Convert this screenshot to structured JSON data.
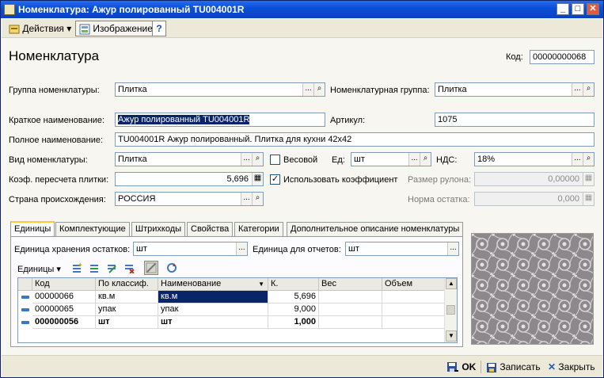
{
  "window": {
    "title": "Номенклатура: Ажур полированный TU004001R"
  },
  "toolbar": {
    "actions_label": "Действия",
    "image_label": "Изображение",
    "help_label": "?"
  },
  "form": {
    "heading": "Номенклатура",
    "code_label": "Код:",
    "code_value": "00000000068",
    "group_label": "Группа номенклатуры:",
    "group_value": "Плитка",
    "nom_group_label": "Номенклатурная группа:",
    "nom_group_value": "Плитка",
    "short_name_label": "Краткое наименование:",
    "short_name_value": "Ажур полированный TU004001R",
    "article_label": "Артикул:",
    "article_value": "1075",
    "full_name_label": "Полное наименование:",
    "full_name_value": "TU004001R Ажур полированный. Плитка для кухни 42x42",
    "type_label": "Вид номенклатуры:",
    "type_value": "Плитка",
    "weight_label": "Весовой",
    "unit_label": "Ед:",
    "unit_value": "шт",
    "vat_label": "НДС:",
    "vat_value": "18%",
    "coef_label": "Коэф. пересчета плитки:",
    "coef_value": "5,696",
    "use_coef_label": "Использовать коэффициент",
    "roll_label": "Размер рулона:",
    "roll_value": "0,00000",
    "country_label": "Страна происхождения:",
    "country_value": "РОССИЯ",
    "rest_label": "Норма остатка:",
    "rest_value": "0,000",
    "dots": "...",
    "search": "🔍"
  },
  "tabs": [
    "Единицы",
    "Комплектующие",
    "Штрихкоды",
    "Свойства",
    "Категории",
    "Дополнительное описание номенклатуры"
  ],
  "units_panel": {
    "storage_label": "Единица хранения остатков:",
    "storage_value": "шт",
    "report_label": "Единица для отчетов:",
    "report_value": "шт",
    "units_menu": "Единицы"
  },
  "table": {
    "columns": [
      "Код",
      "По классиф.",
      "Наименование",
      "К.",
      "Вес",
      "Объем"
    ],
    "rows": [
      [
        "00000066",
        "кв.м",
        "кв.м",
        "5,696",
        "",
        ""
      ],
      [
        "00000065",
        "упак",
        "упак",
        "9,000",
        "",
        ""
      ],
      [
        "000000056",
        "шт",
        "шт",
        "1,000",
        "",
        ""
      ]
    ]
  },
  "footer": {
    "ok_label": "OK",
    "save_label": "Записать",
    "close_label": "Закрыть"
  }
}
